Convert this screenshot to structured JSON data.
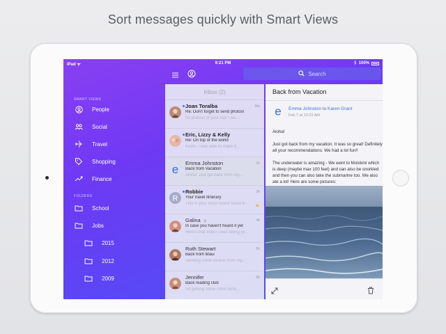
{
  "headline": "Sort messages quickly with Smart Views",
  "status_bar": {
    "device": "iPad",
    "time": "9:21 PM",
    "battery": "100%"
  },
  "sidebar": {
    "smart_views_title": "SMART VIEWS",
    "smart_views": [
      {
        "label": "People",
        "icon": "person-icon"
      },
      {
        "label": "Social",
        "icon": "group-icon"
      },
      {
        "label": "Travel",
        "icon": "plane-icon"
      },
      {
        "label": "Shopping",
        "icon": "tag-icon"
      },
      {
        "label": "Finance",
        "icon": "trend-icon"
      }
    ],
    "folders_title": "FOLDERS",
    "folders": [
      {
        "label": "School"
      },
      {
        "label": "Jobs"
      },
      {
        "label": "2015"
      },
      {
        "label": "2012"
      },
      {
        "label": "2009"
      }
    ]
  },
  "search": {
    "placeholder": "Search"
  },
  "inbox": {
    "title": "Inbox (2)",
    "messages": [
      {
        "name": "Joan Toralba",
        "subject": "Re: Don't forget to send photos!",
        "snippet": "So jealous of your trip! I wo...",
        "time": "8m",
        "unread": true
      },
      {
        "name": "Eric, Lizzy & Kelly",
        "subject": "Re: On top of the world",
        "snippet": "Kevin, I was able to make it...",
        "time": "",
        "unread": true
      },
      {
        "name": "Emma Johnston",
        "subject": "Back from Vacation",
        "snippet": "Aloha! Just got back from my...",
        "time": "1h",
        "unread": false
      },
      {
        "name": "Robbie",
        "subject": "Your travel itinerary",
        "snippet": "This is your most recent travel in...",
        "time": "2h",
        "unread": true,
        "starred": true
      },
      {
        "name": "Galina",
        "count": "3",
        "subject": "In case you haven't heard it yet",
        "snippet": "Here's that video I was telling yo...",
        "time": "4h",
        "unread": false
      },
      {
        "name": "Ruth Stewart",
        "subject": "Back from Maui",
        "snippet": "Sending some photos from my...",
        "time": "5h",
        "unread": false
      },
      {
        "name": "Jennifer",
        "subject": "Back reading club",
        "snippet": "So getting some more book...",
        "time": "6h",
        "unread": false
      }
    ]
  },
  "reader": {
    "title": "Back from Vacation",
    "from": "Emma Johnston",
    "to_word": "to",
    "to": "Karen Grant",
    "date": "Feb 7 at 10:23 AM",
    "body": "Aloha!\n\nJust got back from my vacation. It was so great! Definitely all your recommendations. We had a lot fun!!\n\nThe underwater is amazing - We went to Molokini which is deep (maybe max 100 feet) and can also be snorkled and then you can also take the submarine too. We also ate a lot! Here are some pictures:"
  },
  "colors": {
    "sidebar_top": "#8a3ff2",
    "sidebar_bottom": "#4a55f3",
    "accent_blue": "#3b6fd8",
    "star": "#f3b53a"
  }
}
